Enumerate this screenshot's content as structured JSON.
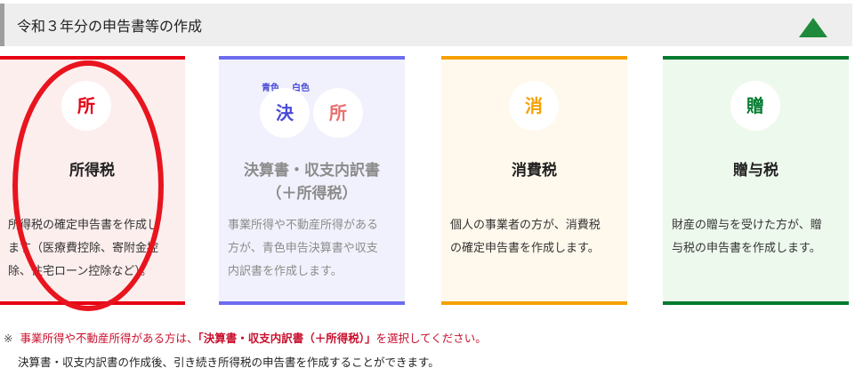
{
  "section": {
    "title": "令和３年分の申告書等の作成"
  },
  "colors": {
    "income": "#e60012",
    "kessan": "#6c6cf0",
    "consumption": "#f6a000",
    "gift": "#007a2e",
    "toggle": "#1e8a3c"
  },
  "cards": {
    "income": {
      "icon_char": "所",
      "name": "所得税",
      "desc": [
        "所得税の確定申告書を作成し",
        "ます（医療費控除、寄附金控",
        "除、住宅ローン控除など）。"
      ]
    },
    "kessan": {
      "tag_blue": "青色",
      "tag_white": "白色",
      "icon_char_1": "決",
      "icon_char_2": "所",
      "name_line1": "決算書・収支内訳書",
      "name_line2": "（＋所得税）",
      "desc": [
        "事業所得や不動産所得がある",
        "方が、青色申告決算書や収支",
        "内訳書を作成します。"
      ]
    },
    "consumption": {
      "icon_char": "消",
      "name": "消費税",
      "desc": [
        "個人の事業者の方が、消費税",
        "の確定申告書を作成します。"
      ]
    },
    "gift": {
      "icon_char": "贈",
      "name": "贈与税",
      "desc": [
        "財産の贈与を受けた方が、贈",
        "与税の申告書を作成します。"
      ]
    }
  },
  "notes": {
    "prefix": "※",
    "line1_before": "事業所得や不動産所得がある方は、",
    "line1_highlight": "「決算書・収支内訳書（＋所得税）」",
    "line1_after": "を選択してください。",
    "line2": "決算書・収支内訳書の作成後、引き続き所得税の申告書を作成することができます。"
  }
}
